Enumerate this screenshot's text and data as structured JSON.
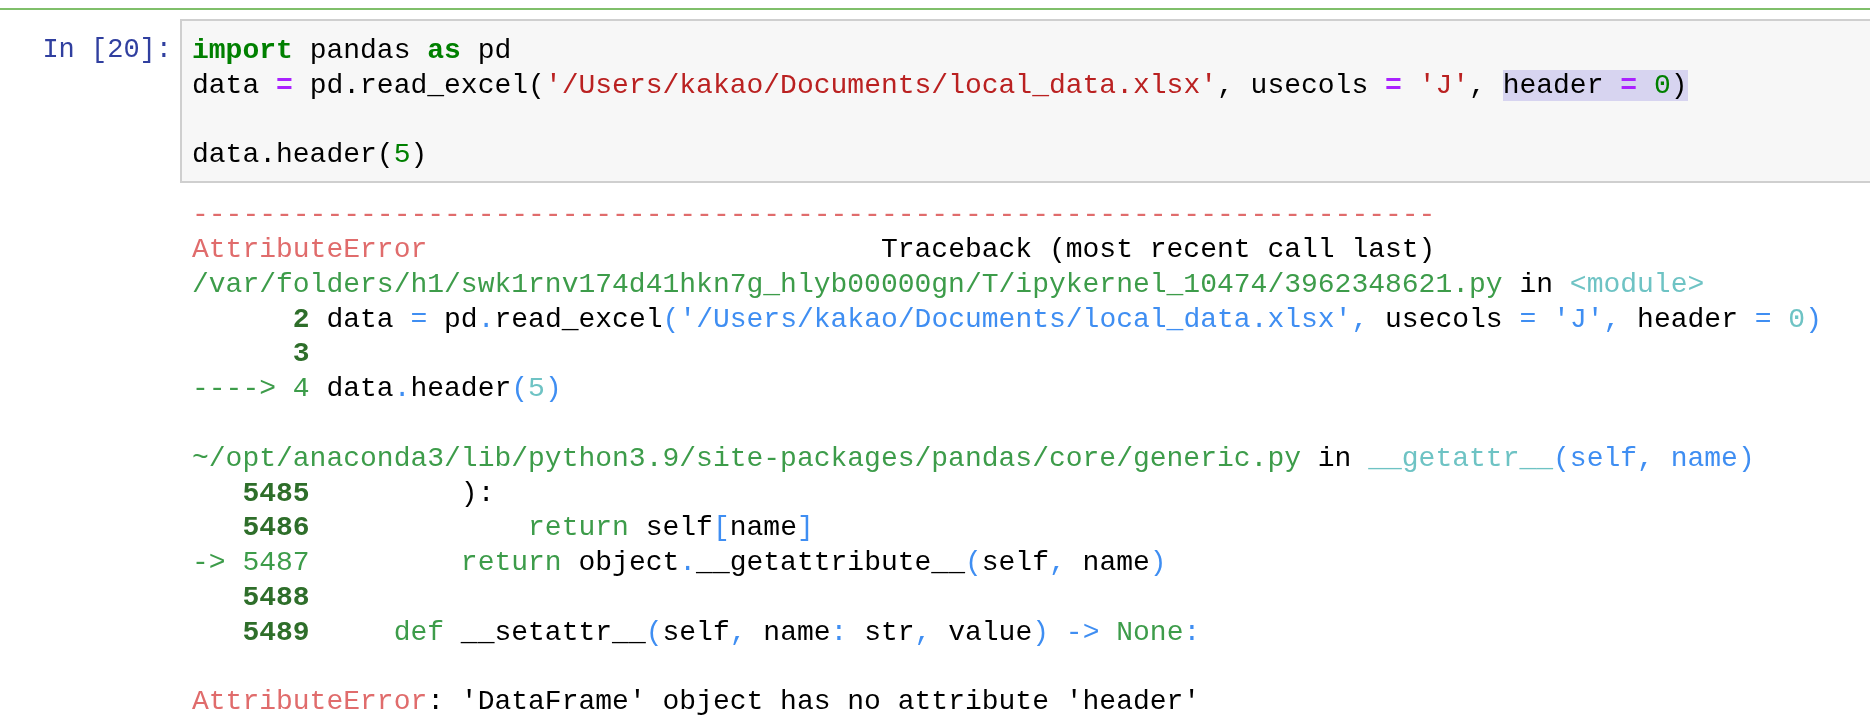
{
  "cell": {
    "prompt": "In [20]:",
    "input": [
      {
        "kind": "code",
        "tokens": [
          {
            "kind": "kw",
            "text": "import"
          },
          {
            "kind": "plain",
            "text": " pandas "
          },
          {
            "kind": "kw",
            "text": "as"
          },
          {
            "kind": "plain",
            "text": " pd"
          }
        ]
      },
      {
        "kind": "code",
        "tokens": [
          {
            "kind": "plain",
            "text": "data "
          },
          {
            "kind": "op",
            "text": "="
          },
          {
            "kind": "plain",
            "text": " pd.read_excel("
          },
          {
            "kind": "str",
            "text": "'/Users/kakao/Documents/local_data.xlsx'"
          },
          {
            "kind": "plain",
            "text": ", usecols "
          },
          {
            "kind": "op",
            "text": "="
          },
          {
            "kind": "str",
            "text": " 'J'"
          },
          {
            "kind": "plain",
            "text": ", "
          },
          {
            "kind": "highlight",
            "tokens": [
              {
                "kind": "plain",
                "text": "header "
              },
              {
                "kind": "op",
                "text": "="
              },
              {
                "kind": "num",
                "text": " 0"
              },
              {
                "kind": "plain",
                "text": ")"
              }
            ]
          }
        ]
      },
      {
        "kind": "blank"
      },
      {
        "kind": "code",
        "tokens": [
          {
            "kind": "plain",
            "text": "data.header("
          },
          {
            "kind": "num",
            "text": "5"
          },
          {
            "kind": "plain",
            "text": ")"
          }
        ]
      }
    ],
    "output": [
      {
        "kind": "code",
        "tokens": [
          {
            "kind": "err",
            "text": "--------------------------------------------------------------------------"
          }
        ]
      },
      {
        "kind": "code",
        "tokens": [
          {
            "kind": "err",
            "text": "AttributeError"
          },
          {
            "kind": "plain",
            "text": "                           Traceback (most recent call last)"
          }
        ]
      },
      {
        "kind": "code",
        "tokens": [
          {
            "kind": "path",
            "text": "/var/folders/h1/swk1rnv174d41hkn7g_hlyb00000gn/T/ipykernel_10474/3962348621.py"
          },
          {
            "kind": "plain",
            "text": " in "
          },
          {
            "kind": "cyan",
            "text": "<module>"
          }
        ]
      },
      {
        "kind": "code",
        "tokens": [
          {
            "kind": "lineno",
            "text": "      2"
          },
          {
            "kind": "plain",
            "text": " data "
          },
          {
            "kind": "blue",
            "text": "="
          },
          {
            "kind": "plain",
            "text": " pd"
          },
          {
            "kind": "blue",
            "text": "."
          },
          {
            "kind": "plain",
            "text": "read_excel"
          },
          {
            "kind": "blue",
            "text": "('/Users/kakao/Documents/local_data.xlsx',"
          },
          {
            "kind": "plain",
            "text": " usecols "
          },
          {
            "kind": "blue",
            "text": "= 'J',"
          },
          {
            "kind": "plain",
            "text": " header "
          },
          {
            "kind": "blue",
            "text": "="
          },
          {
            "kind": "cyan",
            "text": " 0"
          },
          {
            "kind": "blue",
            "text": ")"
          }
        ]
      },
      {
        "kind": "code",
        "tokens": [
          {
            "kind": "lineno",
            "text": "      3"
          }
        ]
      },
      {
        "kind": "code",
        "tokens": [
          {
            "kind": "arrow",
            "text": "----> 4"
          },
          {
            "kind": "plain",
            "text": " data"
          },
          {
            "kind": "blue",
            "text": "."
          },
          {
            "kind": "plain",
            "text": "header"
          },
          {
            "kind": "blue",
            "text": "("
          },
          {
            "kind": "cyan",
            "text": "5"
          },
          {
            "kind": "blue",
            "text": ")"
          }
        ]
      },
      {
        "kind": "blank"
      },
      {
        "kind": "code",
        "tokens": [
          {
            "kind": "path",
            "text": "~/opt/anaconda3/lib/python3.9/site-packages/pandas/core/generic.py"
          },
          {
            "kind": "plain",
            "text": " in "
          },
          {
            "kind": "cyan",
            "text": "__getattr__"
          },
          {
            "kind": "blue",
            "text": "(self, name)"
          }
        ]
      },
      {
        "kind": "code",
        "tokens": [
          {
            "kind": "lineno",
            "text": "   5485"
          },
          {
            "kind": "plain",
            "text": "         ):"
          }
        ]
      },
      {
        "kind": "code",
        "tokens": [
          {
            "kind": "lineno",
            "text": "   5486"
          },
          {
            "kind": "green",
            "text": "             return"
          },
          {
            "kind": "plain",
            "text": " self"
          },
          {
            "kind": "blue",
            "text": "["
          },
          {
            "kind": "plain",
            "text": "name"
          },
          {
            "kind": "blue",
            "text": "]"
          }
        ]
      },
      {
        "kind": "code",
        "tokens": [
          {
            "kind": "arrow",
            "text": "-> 5487"
          },
          {
            "kind": "green",
            "text": "         return"
          },
          {
            "kind": "plain",
            "text": " object"
          },
          {
            "kind": "blue",
            "text": "."
          },
          {
            "kind": "plain",
            "text": "__getattribute__"
          },
          {
            "kind": "blue",
            "text": "("
          },
          {
            "kind": "plain",
            "text": "self"
          },
          {
            "kind": "blue",
            "text": ","
          },
          {
            "kind": "plain",
            "text": " name"
          },
          {
            "kind": "blue",
            "text": ")"
          }
        ]
      },
      {
        "kind": "code",
        "tokens": [
          {
            "kind": "lineno",
            "text": "   5488"
          }
        ]
      },
      {
        "kind": "code",
        "tokens": [
          {
            "kind": "lineno",
            "text": "   5489"
          },
          {
            "kind": "green",
            "text": "     def"
          },
          {
            "kind": "plain",
            "text": " __setattr__"
          },
          {
            "kind": "blue",
            "text": "("
          },
          {
            "kind": "plain",
            "text": "self"
          },
          {
            "kind": "blue",
            "text": ","
          },
          {
            "kind": "plain",
            "text": " name"
          },
          {
            "kind": "blue",
            "text": ":"
          },
          {
            "kind": "plain",
            "text": " str"
          },
          {
            "kind": "blue",
            "text": ","
          },
          {
            "kind": "plain",
            "text": " value"
          },
          {
            "kind": "blue",
            "text": ") ->"
          },
          {
            "kind": "green",
            "text": " None"
          },
          {
            "kind": "blue",
            "text": ":"
          }
        ]
      },
      {
        "kind": "blank"
      },
      {
        "kind": "code",
        "tokens": [
          {
            "kind": "err",
            "text": "AttributeError"
          },
          {
            "kind": "plain",
            "text": ": 'DataFrame' object has no attribute 'header'"
          }
        ]
      }
    ]
  }
}
